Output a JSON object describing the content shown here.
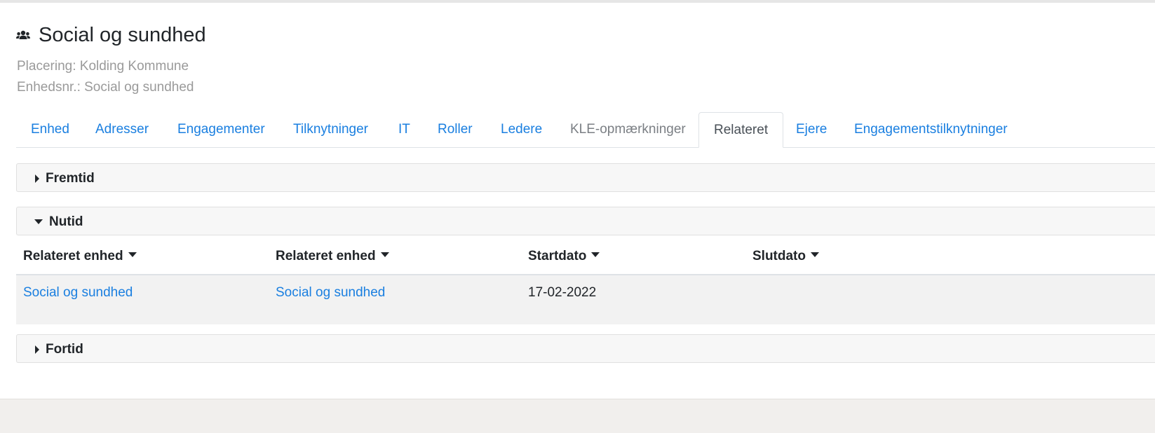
{
  "unit": {
    "icon": "users-icon",
    "title": "Social og sundhed",
    "placement": "Placering: Kolding Kommune",
    "unit_number": "Enhedsnr.: Social og sundhed"
  },
  "tabs": [
    {
      "label": "Enhed",
      "state": "link"
    },
    {
      "label": "Adresser",
      "state": "link"
    },
    {
      "label": "Engagementer",
      "state": "link"
    },
    {
      "label": "Tilknytninger",
      "state": "link"
    },
    {
      "label": "IT",
      "state": "link"
    },
    {
      "label": "Roller",
      "state": "link"
    },
    {
      "label": "Ledere",
      "state": "link"
    },
    {
      "label": "KLE-opmærkninger",
      "state": "disabled"
    },
    {
      "label": "Relateret",
      "state": "active"
    },
    {
      "label": "Ejere",
      "state": "link"
    },
    {
      "label": "Engagementstilknytninger",
      "state": "link"
    }
  ],
  "sections": {
    "future": {
      "label": "Fremtid",
      "expanded": false
    },
    "present": {
      "label": "Nutid",
      "expanded": true
    },
    "past": {
      "label": "Fortid",
      "expanded": false
    }
  },
  "table": {
    "columns": [
      "Relateret enhed",
      "Relateret enhed",
      "Startdato",
      "Slutdato"
    ],
    "rows": [
      [
        "Social og sundhed",
        "Social og sundhed",
        "17-02-2022",
        ""
      ]
    ]
  },
  "colors": {
    "link": "#1a7fe0",
    "muted": "#9a9a9a",
    "row_bg": "#f2f2f2",
    "panel_bg": "#f7f7f7"
  }
}
